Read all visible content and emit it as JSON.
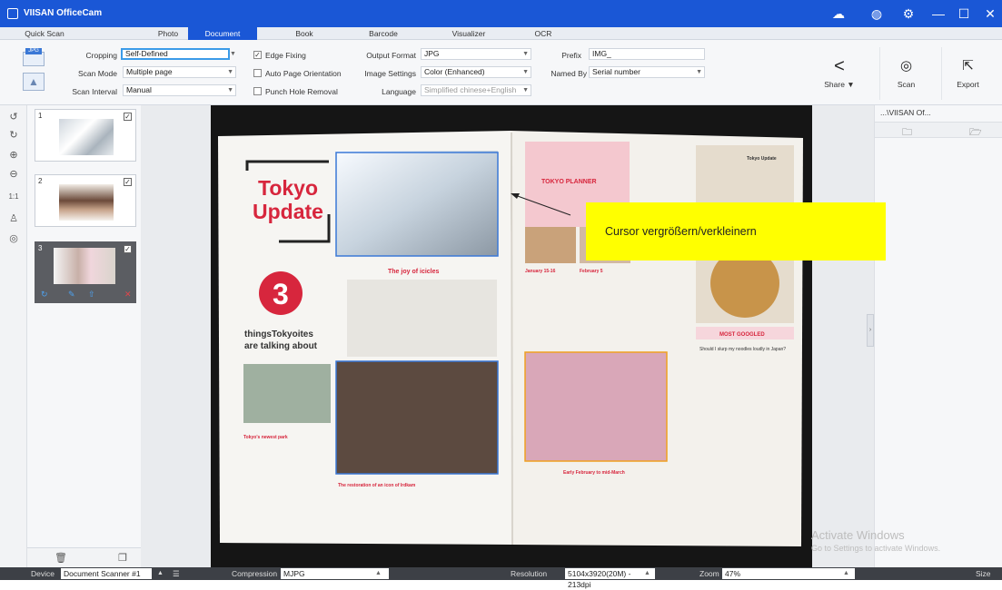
{
  "app": {
    "title": "VIISAN OfficeCam"
  },
  "tabs": [
    "Quick Scan",
    "Photo",
    "Document",
    "Book",
    "Barcode",
    "Visualizer",
    "OCR"
  ],
  "active_tab": "Document",
  "toolbar": {
    "cropping_label": "Cropping",
    "cropping_value": "Self-Defined",
    "scan_mode_label": "Scan Mode",
    "scan_mode_value": "Multiple page",
    "scan_interval_label": "Scan Interval",
    "scan_interval_value": "Manual",
    "edge_fixing": "Edge Fixing",
    "auto_orientation": "Auto Page Orientation",
    "punch_hole": "Punch Hole Removal",
    "output_format_label": "Output Format",
    "output_format_value": "JPG",
    "image_settings_label": "Image Settings",
    "image_settings_value": "Color (Enhanced)",
    "language_label": "Language",
    "language_value": "Simplified chinese+English",
    "prefix_label": "Prefix",
    "prefix_value": "IMG_",
    "named_by_label": "Named By",
    "named_by_value": "Serial number",
    "format_badge": "JPG",
    "share_label": "Share ▼",
    "scan_label": "Scan",
    "export_label": "Export"
  },
  "thumbnails": [
    {
      "num": "1"
    },
    {
      "num": "2"
    },
    {
      "num": "3"
    }
  ],
  "right_panel": {
    "title": "...\\VIISAN Of..."
  },
  "callout": "Cursor vergrößern/verkleinern",
  "magazine": {
    "headline_1": "Tokyo",
    "headline_2": "Update",
    "big_number": "3",
    "subhead_1": "thingsTokyoites",
    "subhead_2": "are talking about",
    "article_1": "The joy of icicles",
    "article_2": "Tokyo's newest park",
    "article_3": "The restoration of an icon of Irdkam",
    "tokyo_planner": "TOKYO PLANNER",
    "date_1": "January 15-16",
    "date_2": "February 5",
    "date_3": "Early February to mid-March",
    "right_title": "Tokyo Update",
    "most_googled": "MOST GOOGLED",
    "question": "Should I slurp my noodles loudly in Japan?"
  },
  "status": {
    "device_label": "Device",
    "device_value": "Document Scanner #1",
    "compression_label": "Compression",
    "compression_value": "MJPG",
    "resolution_label": "Resolution",
    "resolution_value": "5104x3920(20M) - 213dpi",
    "zoom_label": "Zoom",
    "zoom_value": "47%",
    "size_label": "Size"
  },
  "watermark": {
    "line1": "Activate Windows",
    "line2": "Go to Settings to activate Windows."
  },
  "colors": {
    "brand": "#1a57d6",
    "accent_red": "#d7263d",
    "highlight": "#ffff00"
  }
}
